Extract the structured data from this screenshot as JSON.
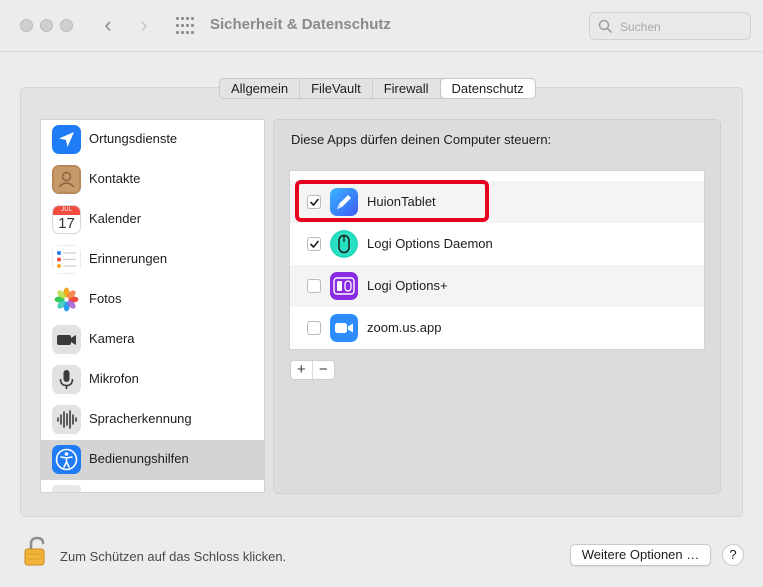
{
  "window": {
    "title": "Sicherheit & Datenschutz",
    "back_glyph": "‹",
    "forward_glyph": "›"
  },
  "search": {
    "placeholder": "Suchen",
    "value": ""
  },
  "tabs": [
    {
      "label": "Allgemein",
      "active": false
    },
    {
      "label": "FileVault",
      "active": false
    },
    {
      "label": "Firewall",
      "active": false
    },
    {
      "label": "Datenschutz",
      "active": true
    }
  ],
  "sidebar": {
    "items": [
      {
        "label": "Ortungsdienste",
        "icon": "location-arrow-icon"
      },
      {
        "label": "Kontakte",
        "icon": "contacts-icon"
      },
      {
        "label": "Kalender",
        "icon": "calendar-icon",
        "calendar_month": "JUL",
        "calendar_day": "17"
      },
      {
        "label": "Erinnerungen",
        "icon": "reminders-icon"
      },
      {
        "label": "Fotos",
        "icon": "photos-icon"
      },
      {
        "label": "Kamera",
        "icon": "camera-icon"
      },
      {
        "label": "Mikrofon",
        "icon": "microphone-icon"
      },
      {
        "label": "Spracherkennung",
        "icon": "waveform-icon"
      },
      {
        "label": "Bedienungshilfen",
        "icon": "accessibility-icon",
        "selected": true
      }
    ]
  },
  "panel": {
    "heading": "Diese Apps dürfen deinen Computer steuern:",
    "apps": [
      {
        "name": "HuionTablet",
        "checked": true,
        "icon": "huion-pen-icon",
        "highlighted": true
      },
      {
        "name": "Logi Options Daemon",
        "checked": true,
        "icon": "logi-mouse-icon"
      },
      {
        "name": "Logi Options+",
        "checked": false,
        "icon": "logi-options-plus-icon"
      },
      {
        "name": "zoom.us.app",
        "checked": false,
        "icon": "zoom-camera-icon"
      }
    ],
    "add_label": "+",
    "remove_label": "−"
  },
  "footer": {
    "lock_text": "Zum Schützen auf das Schloss klicken.",
    "more_options": "Weitere Optionen …",
    "help": "?"
  },
  "colors": {
    "highlight": "#e5001d",
    "accent_blue": "#1f7cf6",
    "selection": "#d4d4d4"
  }
}
